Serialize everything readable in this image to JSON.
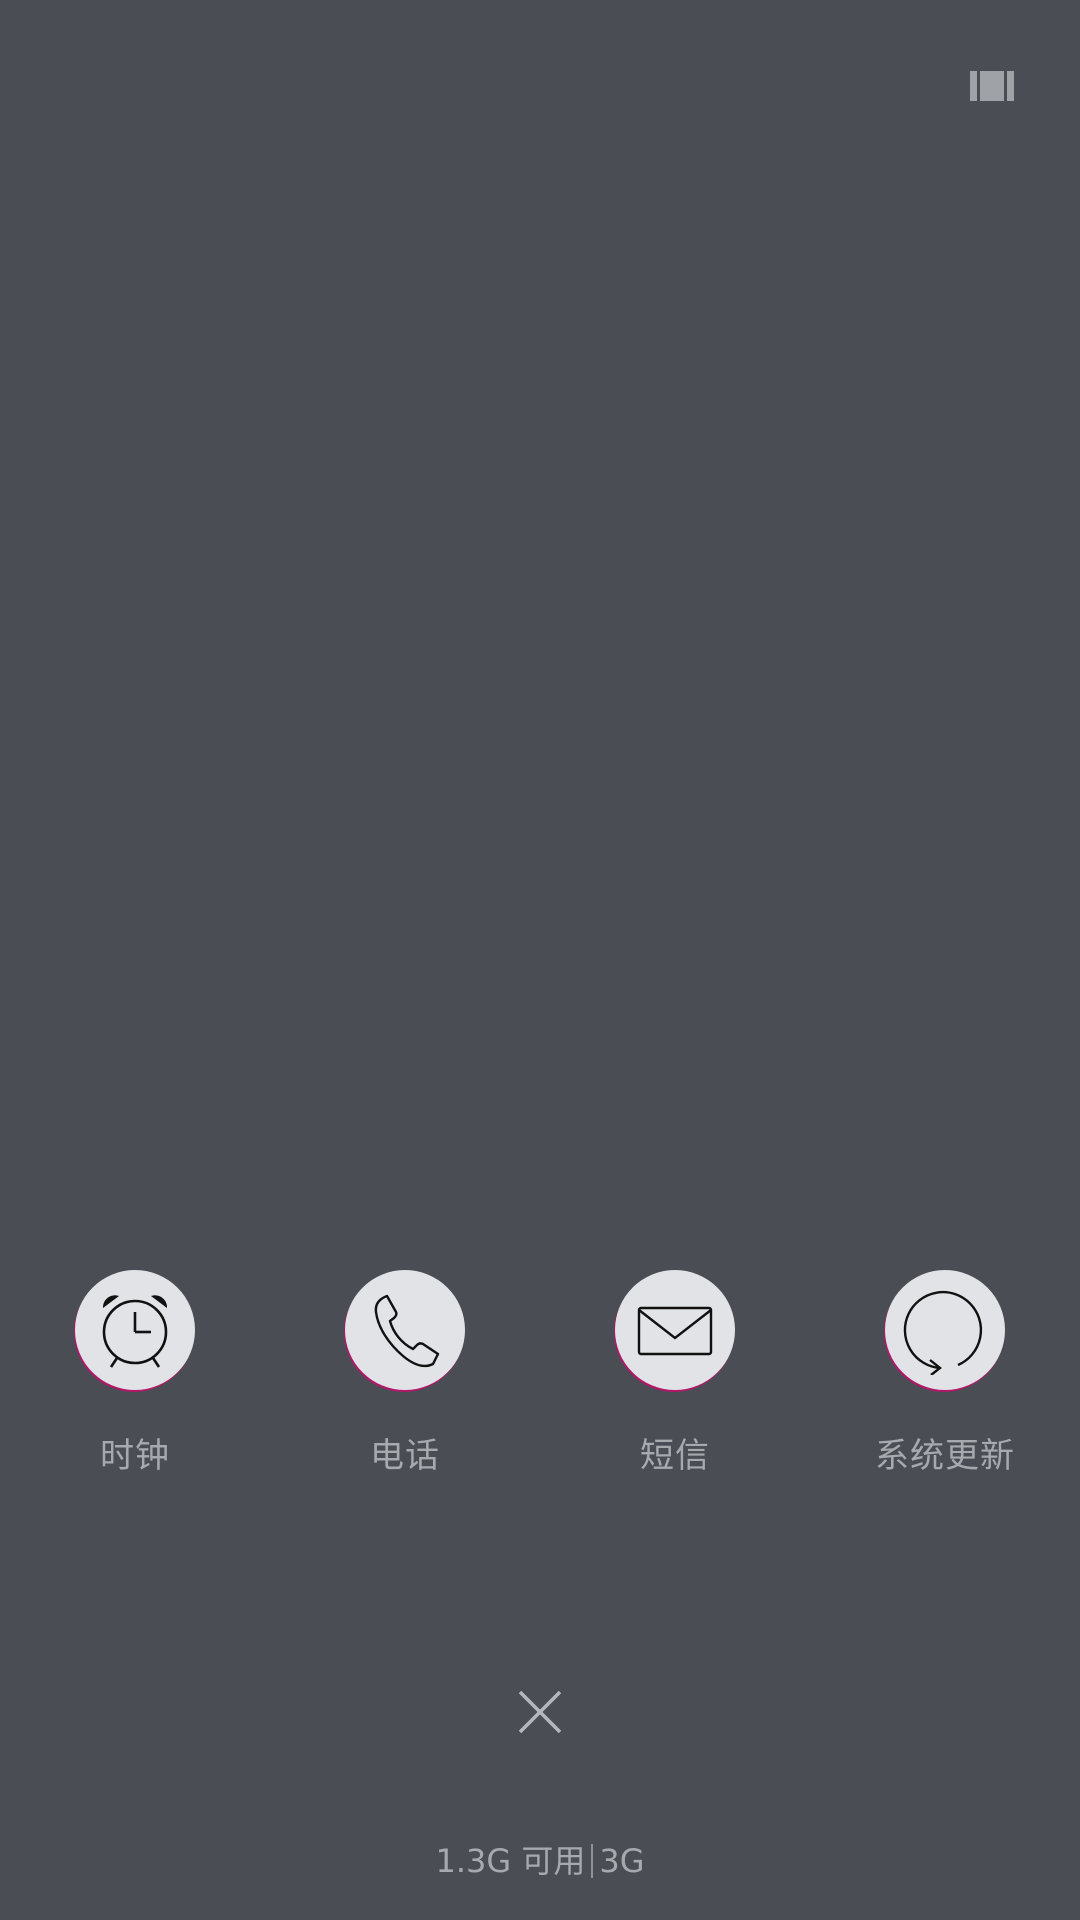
{
  "apps": [
    {
      "label": "时钟",
      "icon": "alarm-clock-icon"
    },
    {
      "label": "电话",
      "icon": "phone-handset-icon"
    },
    {
      "label": "短信",
      "icon": "envelope-icon"
    },
    {
      "label": "系统更新",
      "icon": "refresh-icon"
    }
  ],
  "memory": {
    "available": "1.3G 可用",
    "total": "3G"
  },
  "icons": {
    "top_right": "multi-window-toggle-icon",
    "close": "close-icon"
  },
  "colors": {
    "background": "#4a4e54",
    "icon_circle": "#e2e3e6",
    "text": "#a6a9ad",
    "accent_rim": "#b0186a"
  }
}
